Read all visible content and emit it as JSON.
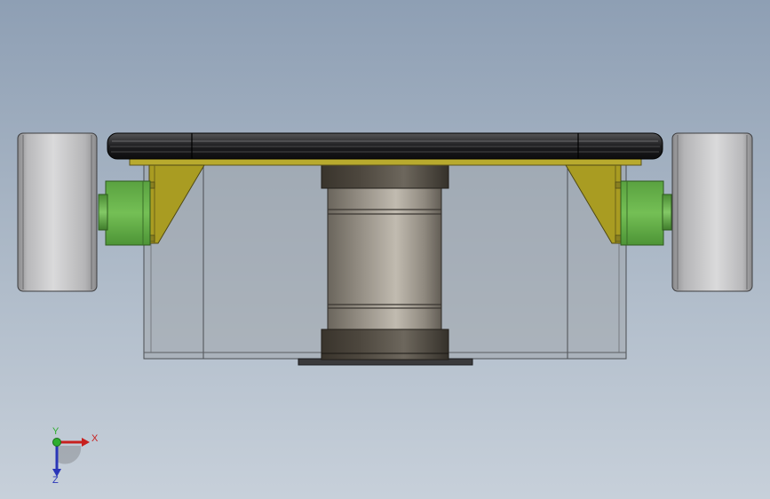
{
  "viewport": {
    "background_top": "#8e9fb4",
    "background_bottom": "#c7d0da"
  },
  "colors": {
    "wheel": "#c4c4c6",
    "motor": "#6db24f",
    "bracket": "#a59a25",
    "plate": "#2c2c2c",
    "column": "#a39d92",
    "housing": "#9ea3aa"
  },
  "triad": {
    "x_label": "X",
    "y_label": "Y",
    "z_label": "Z",
    "x_color": "#c8201e",
    "y_color": "#2fae2f",
    "z_color": "#2a36b8"
  }
}
